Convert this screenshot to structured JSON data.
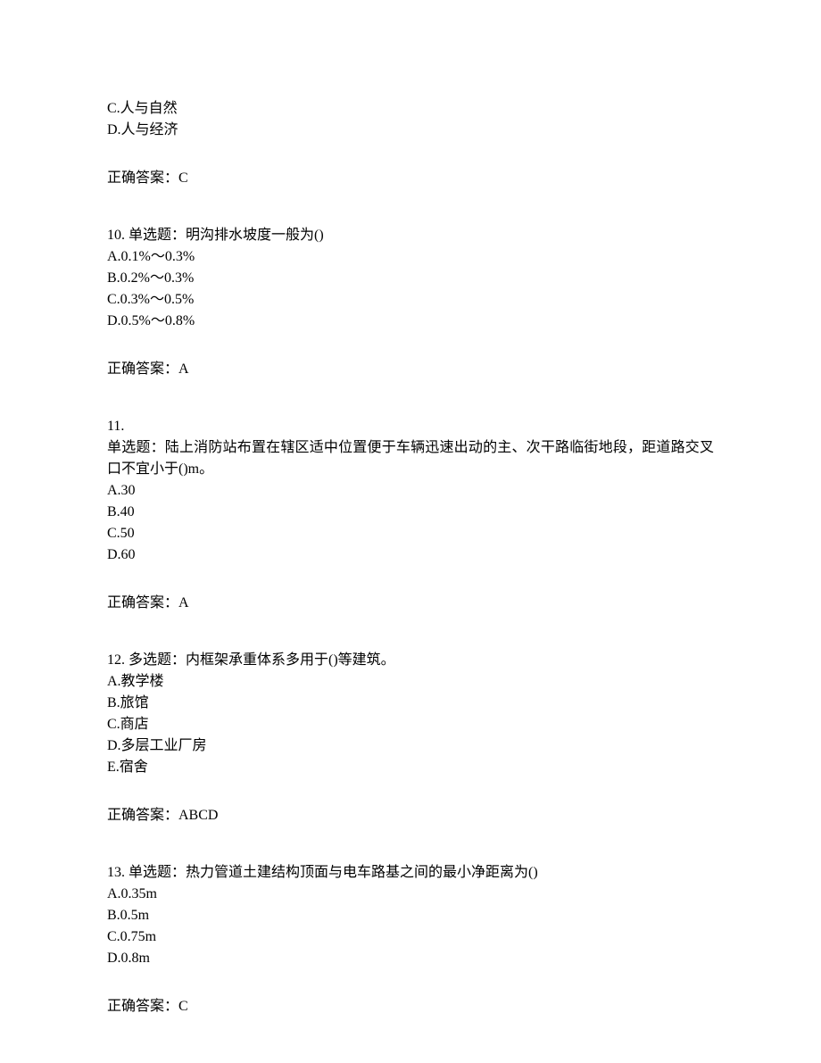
{
  "q9": {
    "optionC": "C.人与自然",
    "optionD": "D.人与经济",
    "answerLabel": "正确答案：C"
  },
  "q10": {
    "stem": "10. 单选题：明沟排水坡度一般为()",
    "optionA": "A.0.1%～0.3%",
    "optionB": "B.0.2%～0.3%",
    "optionC": "C.0.3%～0.5%",
    "optionD": "D.0.5%～0.8%",
    "answerLabel": "正确答案：A"
  },
  "q11": {
    "numLine": "11.",
    "stem": "单选题：陆上消防站布置在辖区适中位置便于车辆迅速出动的主、次干路临街地段，距道路交叉口不宜小于()m。",
    "optionA": "A.30",
    "optionB": "B.40",
    "optionC": "C.50",
    "optionD": "D.60",
    "answerLabel": "正确答案：A"
  },
  "q12": {
    "stem": "12. 多选题：内框架承重体系多用于()等建筑。",
    "optionA": "A.教学楼",
    "optionB": "B.旅馆",
    "optionC": "C.商店",
    "optionD": "D.多层工业厂房",
    "optionE": "E.宿舍",
    "answerLabel": "正确答案：ABCD"
  },
  "q13": {
    "stem": "13. 单选题：热力管道土建结构顶面与电车路基之间的最小净距离为()",
    "optionA": "A.0.35m",
    "optionB": "B.0.5m",
    "optionC": "C.0.75m",
    "optionD": "D.0.8m",
    "answerLabel": "正确答案：C"
  }
}
